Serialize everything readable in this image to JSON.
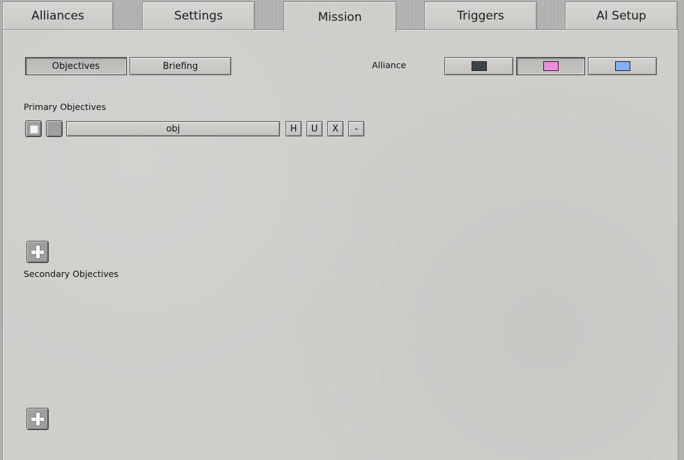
{
  "tabs": [
    {
      "label": "Alliances",
      "active": false
    },
    {
      "label": "Settings",
      "active": false
    },
    {
      "label": "Mission",
      "active": true
    },
    {
      "label": "Triggers",
      "active": false
    },
    {
      "label": "AI Setup",
      "active": false
    }
  ],
  "subtabs": {
    "objectives_label": "Objectives",
    "briefing_label": "Briefing",
    "selected": "Objectives"
  },
  "alliance": {
    "label": "Alliance",
    "options": [
      {
        "color": "#3d4348",
        "selected": false
      },
      {
        "color": "#f08be0",
        "selected": true
      },
      {
        "color": "#7fb1f6",
        "selected": false
      }
    ]
  },
  "primary": {
    "heading": "Primary Objectives",
    "objective": {
      "checked": false,
      "name": "obj",
      "buttons": [
        "H",
        "U",
        "X",
        "-"
      ]
    },
    "add_icon": "plus-icon"
  },
  "secondary": {
    "heading": "Secondary Objectives",
    "add_icon": "plus-icon"
  }
}
